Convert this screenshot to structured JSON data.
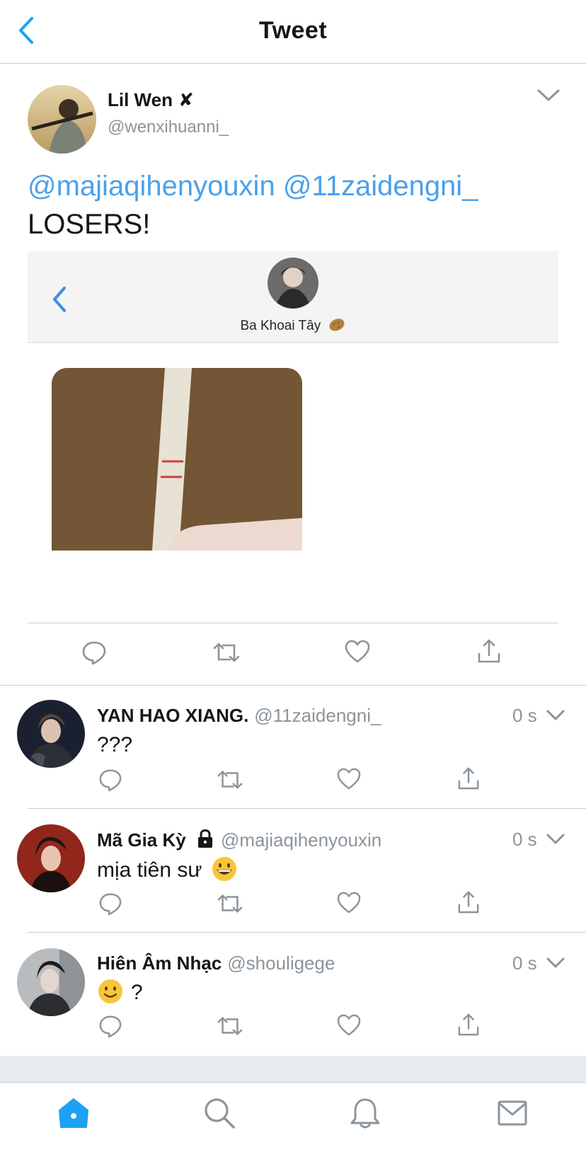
{
  "header": {
    "title": "Tweet",
    "back_icon": "chevron-left-icon"
  },
  "tweet": {
    "author_name": "Lil Wen",
    "author_badge": "✘",
    "author_handle": "@wenxihuanni_",
    "mention_1": "@majiaqihenyouxin",
    "mention_2": "@11zaidengni_",
    "text": "LOSERS!",
    "embed": {
      "chat_name": "Ba Khoai Tây",
      "chat_emoji": "potato-icon"
    }
  },
  "replies": [
    {
      "name": "YAN HAO XIANG.",
      "handle": "@11zaidengni_",
      "time": "0 s",
      "text": "???"
    },
    {
      "name": "Mã Gia Kỳ",
      "badge": "lock-icon",
      "handle": "@majiaqihenyouxin",
      "time": "0 s",
      "text": "mịa tiên sư",
      "emoji": "grinning-face-icon"
    },
    {
      "name": "Hiên Âm Nhạc",
      "handle": "@shouligege",
      "time": "0 s",
      "text": "?",
      "emoji": "slightly-smiling-face-icon"
    }
  ],
  "tabs": [
    "home-icon",
    "search-icon",
    "notifications-icon",
    "messages-icon"
  ],
  "colors": {
    "accent": "#1da1f2",
    "mention": "#4aa1eb",
    "muted": "#8b949c",
    "divider": "#c9cdd1"
  }
}
